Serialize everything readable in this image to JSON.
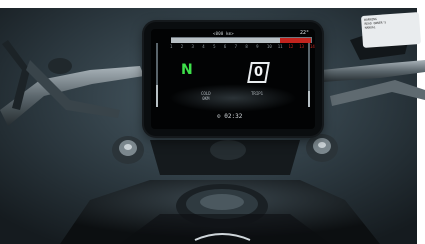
{
  "dashboard": {
    "top_label": "<000 km>",
    "top_right": "22°",
    "rpm_ticks": [
      "1",
      "2",
      "3",
      "4",
      "5",
      "6",
      "7",
      "8",
      "9",
      "10",
      "11",
      "12",
      "13",
      "14"
    ],
    "rpm_level": 0.78,
    "gear": "N",
    "speed": "0",
    "info_left_line1": "COLD",
    "info_left_line2": "0KM",
    "info_right": "TRIP1",
    "clock": "02:32",
    "left_gauge_level": 0.35,
    "right_gauge_level": 0.25
  },
  "sticker": {
    "lines": [
      "WARNING",
      "READ OWNER'S",
      "MANUAL"
    ]
  },
  "colors": {
    "background": "#2c3a42",
    "gear_green": "#3ee04b",
    "redline": "#c3241e"
  }
}
